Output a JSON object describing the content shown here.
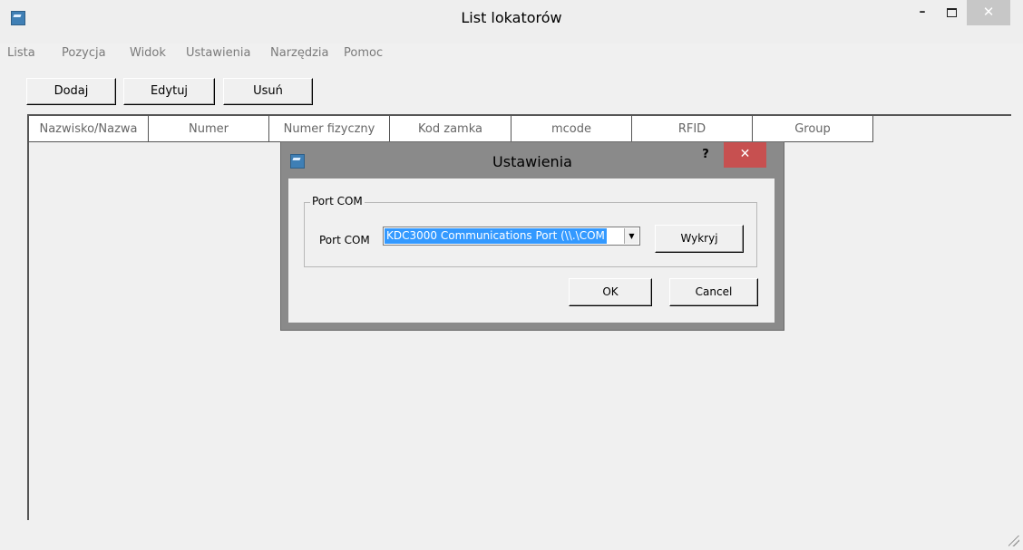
{
  "window": {
    "title": "List lokatorów",
    "minimize": "–",
    "close": "✕"
  },
  "menu": [
    "Lista",
    "Pozycja",
    "Widok",
    "Ustawienia",
    "Narzędzia",
    "Pomoc"
  ],
  "toolbar": {
    "add_label": "Dodaj",
    "edit_label": "Edytuj",
    "delete_label": "Usuń"
  },
  "table": {
    "columns": [
      "Nazwisko/Nazwa",
      "Numer",
      "Numer fizyczny",
      "Kod zamka",
      "mcode",
      "RFID",
      "Group"
    ],
    "rows": []
  },
  "dialog": {
    "title": "Ustawienia",
    "help": "?",
    "close": "✕",
    "group_label": "Port COM",
    "field_label": "Port COM",
    "port_value": "KDC3000 Communications Port (\\\\.\\COM",
    "detect_label": "Wykryj",
    "ok_label": "OK",
    "cancel_label": "Cancel"
  },
  "colors": {
    "close_red": "#c75050",
    "selection": "#3399ff",
    "app_icon": "#3f7fb5"
  }
}
